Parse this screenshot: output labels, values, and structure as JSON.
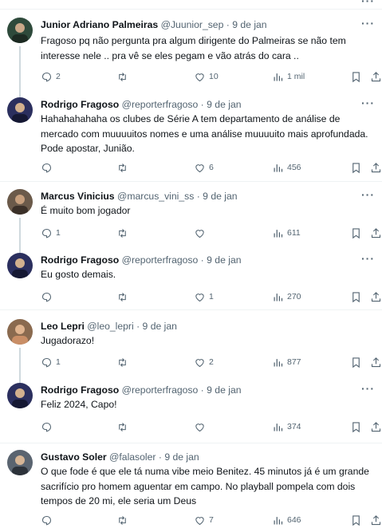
{
  "tweets": [
    {
      "name": "Junior Adriano Palmeiras",
      "handle": "@Juunior_sep",
      "dot": "·",
      "date": "9 de jan",
      "text": "Fragoso pq não pergunta pra algum dirigente do Palmeiras se não tem interesse nele .. pra vê se eles pegam e vão atrás do cara ..",
      "replies": "2",
      "retweets": "",
      "likes": "10",
      "views": "1 mil",
      "avatar_color": "#2e4a3b"
    },
    {
      "name": "Rodrigo Fragoso",
      "handle": "@reporterfragoso",
      "dot": "·",
      "date": "9 de jan",
      "text": "Hahahahahaha os clubes de Série A tem departamento de análise de mercado com muuuuitos nomes e uma análise muuuuito mais aprofundada. Pode apostar, Junião.",
      "replies": "",
      "retweets": "",
      "likes": "6",
      "views": "456",
      "avatar_color": "#2b2f5e"
    },
    {
      "name": "Marcus Vinicius",
      "handle": "@marcus_vini_ss",
      "dot": "·",
      "date": "9 de jan",
      "text": "É muito bom jogador",
      "replies": "1",
      "retweets": "",
      "likes": "",
      "views": "611",
      "avatar_color": "#6b5a4a"
    },
    {
      "name": "Rodrigo Fragoso",
      "handle": "@reporterfragoso",
      "dot": "·",
      "date": "9 de jan",
      "text": "Eu gosto demais.",
      "replies": "",
      "retweets": "",
      "likes": "1",
      "views": "270",
      "avatar_color": "#2b2f5e"
    },
    {
      "name": "Leo Lepri",
      "handle": "@leo_lepri",
      "dot": "·",
      "date": "9 de jan",
      "text": "Jugadorazo!",
      "replies": "1",
      "retweets": "",
      "likes": "2",
      "views": "877",
      "avatar_color": "#8a6a4f"
    },
    {
      "name": "Rodrigo Fragoso",
      "handle": "@reporterfragoso",
      "dot": "·",
      "date": "9 de jan",
      "text": "Feliz 2024, Capo!",
      "replies": "",
      "retweets": "",
      "likes": "",
      "views": "374",
      "avatar_color": "#2b2f5e"
    },
    {
      "name": "Gustavo Soler",
      "handle": "@falasoler",
      "dot": "·",
      "date": "9 de jan",
      "text": "O que fode é que ele tá numa vibe meio Benitez. 45 minutos já é um grande sacrifício pro homem aguentar em campo. No playball pompela com dois tempos de 20 mi, ele seria um Deus",
      "replies": "",
      "retweets": "",
      "likes": "7",
      "views": "646",
      "avatar_color": "#5a6470"
    }
  ],
  "more_label": "···"
}
